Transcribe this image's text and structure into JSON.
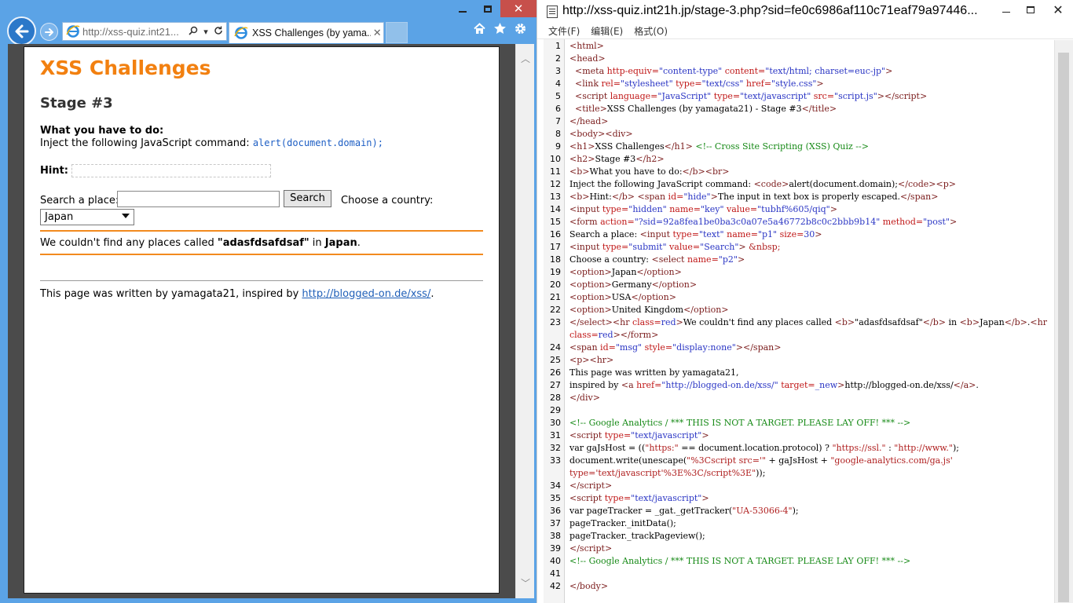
{
  "browser": {
    "address_text": "http://xss-quiz.int21",
    "address_suffix": "...",
    "tab_title": "XSS Challenges (by yama...",
    "icons": [
      "back-arrow-icon",
      "forward-arrow-icon",
      "search-icon",
      "refresh-icon",
      "home-icon",
      "favorites-star-icon",
      "gear-icon"
    ]
  },
  "page": {
    "h1": "XSS Challenges",
    "h2": "Stage #3",
    "task_label": "What you have to do:",
    "task_text": "Inject the following JavaScript command:",
    "task_code": "alert(document.domain);",
    "hint_label": "Hint:",
    "search_label": "Search a place:",
    "search_value": "",
    "search_button": "Search",
    "country_label": "Choose a country:",
    "country_selected": "Japan",
    "msg_prefix": "We couldn't find any places called ",
    "msg_query": "\"adasfdsafdsaf\"",
    "msg_in": " in ",
    "msg_country": "Japan",
    "msg_end": ".",
    "footer_text": "This page was written by yamagata21, inspired by ",
    "footer_link": "http://blogged-on.de/xss/",
    "footer_end": "."
  },
  "source": {
    "url": "http://xss-quiz.int21h.jp/stage-3.php?sid=fe0c6986af110c71eaf79a97446...",
    "menu": [
      "文件(F)",
      "编辑(E)",
      "格式(O)"
    ],
    "lines": [
      {
        "n": "1",
        "html": "<span class=\"t\">&lt;html&gt;</span>"
      },
      {
        "n": "2",
        "html": "<span class=\"t\">&lt;head&gt;</span>"
      },
      {
        "n": "3",
        "html": "  <span class=\"t\">&lt;meta</span> <span class=\"a\">http-equiv=</span><span class=\"v\">\"content-type\"</span> <span class=\"a\">content=</span><span class=\"v\">\"text/html; charset=euc-jp\"</span><span class=\"t\">&gt;</span>"
      },
      {
        "n": "4",
        "html": "  <span class=\"t\">&lt;link</span> <span class=\"a\">rel=</span><span class=\"v\">\"stylesheet\"</span> <span class=\"a\">type=</span><span class=\"v\">\"text/css\"</span> <span class=\"a\">href=</span><span class=\"v\">\"style.css\"</span><span class=\"t\">&gt;</span>"
      },
      {
        "n": "5",
        "html": "  <span class=\"t\">&lt;script</span> <span class=\"a\">language=</span><span class=\"v\">\"JavaScript\"</span> <span class=\"a\">type=</span><span class=\"v\">\"text/javascript\"</span> <span class=\"a\">src=</span><span class=\"v\">\"script.js\"</span><span class=\"t\">&gt;&lt;/script&gt;</span>"
      },
      {
        "n": "6",
        "html": "  <span class=\"t\">&lt;title&gt;</span>XSS Challenges (by yamagata21) - Stage #3<span class=\"t\">&lt;/title&gt;</span>"
      },
      {
        "n": "7",
        "html": "<span class=\"t\">&lt;/head&gt;</span>"
      },
      {
        "n": "8",
        "html": "<span class=\"t\">&lt;body&gt;&lt;div&gt;</span>"
      },
      {
        "n": "9",
        "html": "<span class=\"t\">&lt;h1&gt;</span>XSS Challenges<span class=\"t\">&lt;/h1&gt;</span> <span class=\"c\">&lt;!-- Cross Site Scripting (XSS) Quiz --&gt;</span>"
      },
      {
        "n": "10",
        "html": "<span class=\"t\">&lt;h2&gt;</span>Stage #3<span class=\"t\">&lt;/h2&gt;</span>"
      },
      {
        "n": "11",
        "html": "<span class=\"t\">&lt;b&gt;</span>What you have to do:<span class=\"t\">&lt;/b&gt;&lt;br&gt;</span>"
      },
      {
        "n": "12",
        "html": "Inject the following JavaScript command: <span class=\"t\">&lt;code&gt;</span>alert(document.domain);<span class=\"t\">&lt;/code&gt;&lt;p&gt;</span>"
      },
      {
        "n": "13",
        "html": "<span class=\"t\">&lt;b&gt;</span>Hint:<span class=\"t\">&lt;/b&gt;</span> <span class=\"t\">&lt;span</span> <span class=\"a\">id=</span><span class=\"v\">\"hide\"</span><span class=\"t\">&gt;</span>The input in text box is properly escaped.<span class=\"t\">&lt;/span&gt;</span>"
      },
      {
        "n": "14",
        "html": "<span class=\"t\">&lt;input</span> <span class=\"a\">type=</span><span class=\"v\">\"hidden\"</span> <span class=\"a\">name=</span><span class=\"v\">\"key\"</span> <span class=\"a\">value=</span><span class=\"v\">\"tubhf%605/qiq\"</span><span class=\"t\">&gt;</span>"
      },
      {
        "n": "15",
        "html": "<span class=\"t\">&lt;form</span> <span class=\"a\">action=</span><span class=\"v\">\"?sid=92a8fea1be0ba3c0a07e5a46772b8c0c2bbb9b14\"</span> <span class=\"a\">method=</span><span class=\"v\">\"post\"</span><span class=\"t\">&gt;</span>"
      },
      {
        "n": "16",
        "html": "Search a place: <span class=\"t\">&lt;input</span> <span class=\"a\">type=</span><span class=\"v\">\"text\"</span> <span class=\"a\">name=</span><span class=\"v\">\"p1\"</span> <span class=\"a\">size=</span><span class=\"v\">30</span><span class=\"t\">&gt;</span>"
      },
      {
        "n": "17",
        "html": "<span class=\"t\">&lt;input</span> <span class=\"a\">type=</span><span class=\"v\">\"submit\"</span> <span class=\"a\">value=</span><span class=\"v\">\"Search\"</span><span class=\"t\">&gt;</span> <span class=\"s\">&amp;nbsp;</span>"
      },
      {
        "n": "18",
        "html": "Choose a country: <span class=\"t\">&lt;select</span> <span class=\"a\">name=</span><span class=\"v\">\"p2\"</span><span class=\"t\">&gt;</span>"
      },
      {
        "n": "19",
        "html": "<span class=\"t\">&lt;option&gt;</span>Japan<span class=\"t\">&lt;/option&gt;</span>"
      },
      {
        "n": "20",
        "html": "<span class=\"t\">&lt;option&gt;</span>Germany<span class=\"t\">&lt;/option&gt;</span>"
      },
      {
        "n": "21",
        "html": "<span class=\"t\">&lt;option&gt;</span>USA<span class=\"t\">&lt;/option&gt;</span>"
      },
      {
        "n": "22",
        "html": "<span class=\"t\">&lt;option&gt;</span>United Kingdom<span class=\"t\">&lt;/option&gt;</span>"
      },
      {
        "n": "23",
        "html": "<span class=\"t\">&lt;/select&gt;&lt;hr</span> <span class=\"a\">class=</span><span class=\"v\">red</span><span class=\"t\">&gt;</span>We couldn't find any places called <span class=\"t\">&lt;b&gt;</span>\"adasfdsafdsaf\"<span class=\"t\">&lt;/b&gt;</span> in <span class=\"t\">&lt;b&gt;</span>Japan<span class=\"t\">&lt;/b&gt;</span>.<span class=\"t\">&lt;hr</span>"
      },
      {
        "n": "",
        "html": "<span class=\"a\">class=</span><span class=\"v\">red</span><span class=\"t\">&gt;&lt;/form&gt;</span>"
      },
      {
        "n": "24",
        "html": "<span class=\"t\">&lt;span</span> <span class=\"a\">id=</span><span class=\"v\">\"msg\"</span> <span class=\"a\">style=</span><span class=\"v\">\"display:none\"</span><span class=\"t\">&gt;&lt;/span&gt;</span>"
      },
      {
        "n": "25",
        "html": "<span class=\"t\">&lt;p&gt;&lt;hr&gt;</span>"
      },
      {
        "n": "26",
        "html": "This page was written by yamagata21,"
      },
      {
        "n": "27",
        "html": "inspired by <span class=\"t\">&lt;a</span> <span class=\"a\">href=</span><span class=\"v\">\"http://blogged-on.de/xss/\"</span> <span class=\"a\">target=</span><span class=\"v\">_new</span><span class=\"t\">&gt;</span>http://blogged-on.de/xss/<span class=\"t\">&lt;/a&gt;</span>."
      },
      {
        "n": "28",
        "html": "<span class=\"t\">&lt;/div&gt;</span>"
      },
      {
        "n": "29",
        "html": ""
      },
      {
        "n": "30",
        "html": "<span class=\"c\">&lt;!-- Google Analytics / *** THIS IS NOT A TARGET. PLEASE LAY OFF! *** --&gt;</span>"
      },
      {
        "n": "31",
        "html": "<span class=\"t\">&lt;script</span> <span class=\"a\">type=</span><span class=\"v\">\"text/javascript\"</span><span class=\"t\">&gt;</span>"
      },
      {
        "n": "32",
        "html": "var gaJsHost = ((<span class=\"s\">\"https:\"</span> == document.location.protocol) ? <span class=\"s\">\"https://ssl.\"</span> : <span class=\"s\">\"http://www.\"</span>);"
      },
      {
        "n": "33",
        "html": "document.write(unescape(<span class=\"s\">\"%3Cscript src='\"</span> + gaJsHost + <span class=\"s\">\"google-analytics.com/ga.js'</span>"
      },
      {
        "n": "",
        "html": "<span class=\"s\">type='text/javascript'%3E%3C/script%3E\"</span>));"
      },
      {
        "n": "34",
        "html": "<span class=\"t\">&lt;/script&gt;</span>"
      },
      {
        "n": "35",
        "html": "<span class=\"t\">&lt;script</span> <span class=\"a\">type=</span><span class=\"v\">\"text/javascript\"</span><span class=\"t\">&gt;</span>"
      },
      {
        "n": "36",
        "html": "var pageTracker = _gat._getTracker(<span class=\"s\">\"UA-53066-4\"</span>);"
      },
      {
        "n": "37",
        "html": "pageTracker._initData();"
      },
      {
        "n": "38",
        "html": "pageTracker._trackPageview();"
      },
      {
        "n": "39",
        "html": "<span class=\"t\">&lt;/script&gt;</span>"
      },
      {
        "n": "40",
        "html": "<span class=\"c\">&lt;!-- Google Analytics / *** THIS IS NOT A TARGET. PLEASE LAY OFF! *** --&gt;</span>"
      },
      {
        "n": "41",
        "html": ""
      },
      {
        "n": "42",
        "html": "<span class=\"t\">&lt;/body&gt;</span>"
      }
    ]
  }
}
